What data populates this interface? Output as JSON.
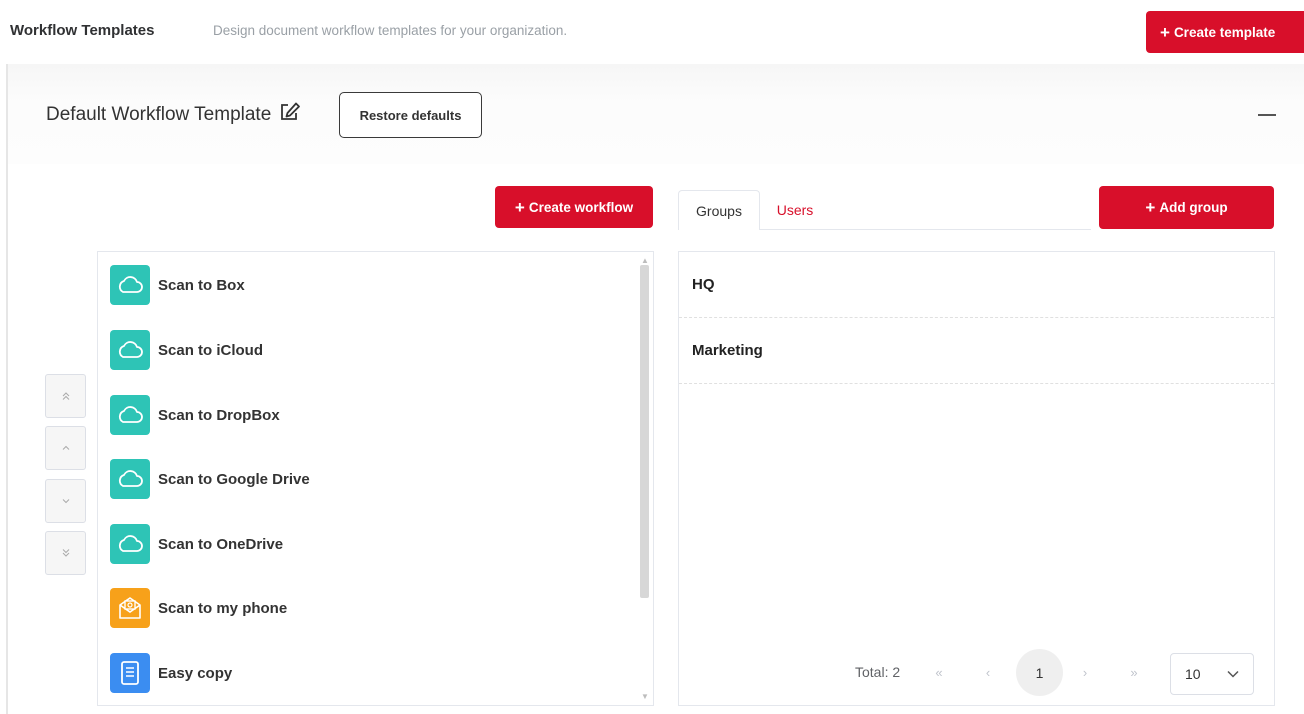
{
  "header": {
    "title": "Workflow Templates",
    "subtitle": "Design document workflow templates for your organization.",
    "create_template_label": "Create template"
  },
  "template": {
    "name": "Default Workflow Template",
    "restore_label": "Restore defaults",
    "collapse_icon": "minus-icon"
  },
  "workflows": {
    "create_label": "Create workflow",
    "items": [
      {
        "label": "Scan to Box",
        "icon": "cloud-icon",
        "color": "#2ec4b6"
      },
      {
        "label": "Scan to iCloud",
        "icon": "cloud-icon",
        "color": "#2ec4b6"
      },
      {
        "label": "Scan to DropBox",
        "icon": "cloud-icon",
        "color": "#2ec4b6"
      },
      {
        "label": "Scan to Google Drive",
        "icon": "cloud-icon",
        "color": "#2ec4b6"
      },
      {
        "label": "Scan to OneDrive",
        "icon": "cloud-icon",
        "color": "#2ec4b6"
      },
      {
        "label": "Scan to my phone",
        "icon": "mail-icon",
        "color": "#f7a11a"
      },
      {
        "label": "Easy copy",
        "icon": "document-icon",
        "color": "#3b8df1"
      }
    ]
  },
  "order_buttons": [
    "move-top-icon",
    "move-up-icon",
    "move-down-icon",
    "move-bottom-icon"
  ],
  "tabs": {
    "groups_label": "Groups",
    "users_label": "Users",
    "active": "Groups"
  },
  "groups": {
    "add_label": "Add group",
    "rows": [
      "HQ",
      "Marketing"
    ]
  },
  "pagination": {
    "total_label": "Total: 2",
    "current_page": "1",
    "page_size": "10"
  },
  "colors": {
    "accent": "#d80f2a",
    "cloud_teal": "#2ec4b6",
    "phone_orange": "#f7a11a",
    "copy_blue": "#3b8df1"
  }
}
